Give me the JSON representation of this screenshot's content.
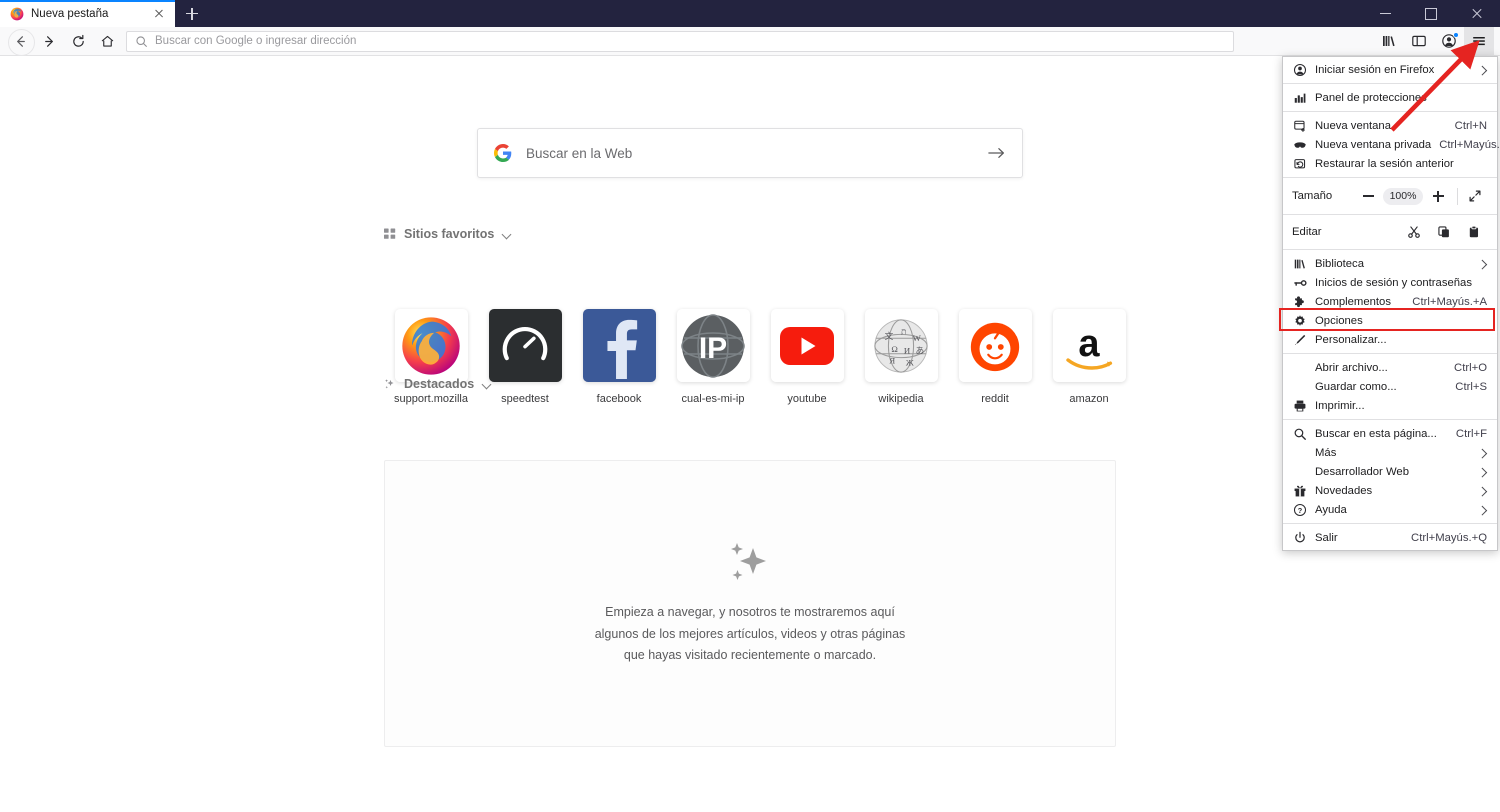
{
  "window": {
    "controls": {
      "minimize": "Minimizar",
      "maximize": "Restaurar",
      "close": "Cerrar"
    }
  },
  "tabs": {
    "active": {
      "title": "Nueva pestaña",
      "favicon": "firefox-logo"
    },
    "new_tab_label": "Nueva pestaña",
    "accent_color": "#0a84ff",
    "bar_color": "#23233f"
  },
  "toolbar": {
    "back_label": "Atrás",
    "forward_label": "Adelante",
    "reload_label": "Recargar",
    "home_label": "Inicio",
    "urlbar": {
      "placeholder": "Buscar con Google o ingresar dirección"
    },
    "library_label": "Biblioteca",
    "sidebar_label": "Barra lateral",
    "account_label": "Cuenta",
    "menu_label": "Abrir menú de la aplicación"
  },
  "newtab": {
    "search": {
      "placeholder": "Buscar en la Web",
      "engine": "Google",
      "submit_label": "Buscar"
    },
    "top_sites": {
      "title": "Sitios favoritos",
      "items": [
        {
          "label": "support.mozilla",
          "icon": "firefox-logo"
        },
        {
          "label": "speedtest",
          "icon": "speedtest-gauge"
        },
        {
          "label": "facebook",
          "icon": "facebook-f"
        },
        {
          "label": "cual-es-mi-ip",
          "icon": "ip-globe"
        },
        {
          "label": "youtube",
          "icon": "youtube-play"
        },
        {
          "label": "wikipedia",
          "icon": "wikipedia-globe"
        },
        {
          "label": "reddit",
          "icon": "reddit-alien"
        },
        {
          "label": "amazon",
          "icon": "amazon-a"
        }
      ]
    },
    "highlights": {
      "title": "Destacados",
      "empty_line1": "Empieza a navegar, y nosotros te mostraremos aquí",
      "empty_line2": "algunos de los mejores artículos, videos y otras páginas",
      "empty_line3": "que hayas visitado recientemente o marcado."
    }
  },
  "app_menu": {
    "highlight_color": "#e52421",
    "groups": [
      {
        "items": [
          {
            "label": "Iniciar sesión en Firefox",
            "icon": "account-circle-icon",
            "submenu": true,
            "accel": ""
          }
        ]
      },
      {
        "items": [
          {
            "label": "Panel de protecciones",
            "icon": "protections-chart-icon",
            "submenu": false,
            "accel": ""
          }
        ]
      },
      {
        "items": [
          {
            "label": "Nueva ventana",
            "icon": "new-window-icon",
            "submenu": false,
            "accel": "Ctrl+N"
          },
          {
            "label": "Nueva ventana privada",
            "icon": "private-mask-icon",
            "submenu": false,
            "accel": "Ctrl+Mayús.+P"
          },
          {
            "label": "Restaurar la sesión anterior",
            "icon": "restore-session-icon",
            "submenu": false,
            "accel": ""
          }
        ]
      },
      {
        "zoom": {
          "label": "Tamaño",
          "minus_label": "Reducir",
          "value": "100%",
          "plus_label": "Aumentar",
          "fullscreen_label": "Pantalla completa"
        }
      },
      {
        "edit": {
          "label": "Editar",
          "cut_label": "Cortar",
          "copy_label": "Copiar",
          "paste_label": "Pegar"
        }
      },
      {
        "items": [
          {
            "label": "Biblioteca",
            "icon": "library-books-icon",
            "submenu": true,
            "accel": ""
          },
          {
            "label": "Inicios de sesión y contraseñas",
            "icon": "key-icon",
            "submenu": false,
            "accel": ""
          },
          {
            "label": "Complementos",
            "icon": "puzzle-piece-icon",
            "submenu": false,
            "accel": "Ctrl+Mayús.+A"
          },
          {
            "label": "Opciones",
            "icon": "gear-icon",
            "submenu": false,
            "accel": "",
            "highlighted": true
          },
          {
            "label": "Personalizar...",
            "icon": "pen-icon",
            "submenu": false,
            "accel": ""
          }
        ]
      },
      {
        "items": [
          {
            "label": "Abrir archivo...",
            "icon": "",
            "submenu": false,
            "accel": "Ctrl+O"
          },
          {
            "label": "Guardar como...",
            "icon": "",
            "submenu": false,
            "accel": "Ctrl+S"
          },
          {
            "label": "Imprimir...",
            "icon": "printer-icon",
            "submenu": false,
            "accel": ""
          }
        ]
      },
      {
        "items": [
          {
            "label": "Buscar en esta página...",
            "icon": "search-icon",
            "submenu": false,
            "accel": "Ctrl+F"
          },
          {
            "label": "Más",
            "icon": "",
            "submenu": true,
            "accel": ""
          },
          {
            "label": "Desarrollador Web",
            "icon": "",
            "submenu": true,
            "accel": ""
          },
          {
            "label": "Novedades",
            "icon": "gift-icon",
            "submenu": true,
            "accel": ""
          },
          {
            "label": "Ayuda",
            "icon": "help-circle-icon",
            "submenu": true,
            "accel": ""
          }
        ]
      },
      {
        "items": [
          {
            "label": "Salir",
            "icon": "power-icon",
            "submenu": false,
            "accel": "Ctrl+Mayús.+Q"
          }
        ]
      }
    ]
  }
}
